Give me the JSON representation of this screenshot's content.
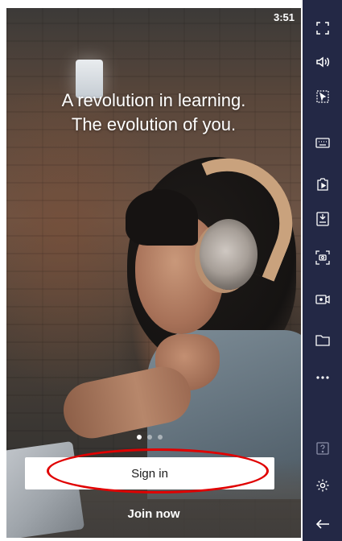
{
  "status_bar": {
    "time": "3:51"
  },
  "onboarding": {
    "headline_line1": "A revolution in learning.",
    "headline_line2": "The evolution of you.",
    "pager": {
      "count": 3,
      "active_index": 0
    },
    "sign_in_label": "Sign in",
    "join_now_label": "Join now"
  },
  "emulator_sidebar": {
    "items": [
      {
        "icon": "fullscreen-icon"
      },
      {
        "icon": "volume-icon"
      },
      {
        "icon": "pointer-select-icon"
      },
      {
        "icon": "keyboard-icon"
      },
      {
        "icon": "install-apk-icon"
      },
      {
        "icon": "apk-download-icon"
      },
      {
        "icon": "screenshot-icon"
      },
      {
        "icon": "screen-record-icon"
      },
      {
        "icon": "folder-icon"
      },
      {
        "icon": "more-icon"
      },
      {
        "icon": "help-icon"
      },
      {
        "icon": "settings-icon"
      },
      {
        "icon": "back-arrow-icon"
      }
    ]
  },
  "colors": {
    "sidebar_bg": "#232845",
    "highlight": "#e00000",
    "button_bg": "#ffffff"
  }
}
